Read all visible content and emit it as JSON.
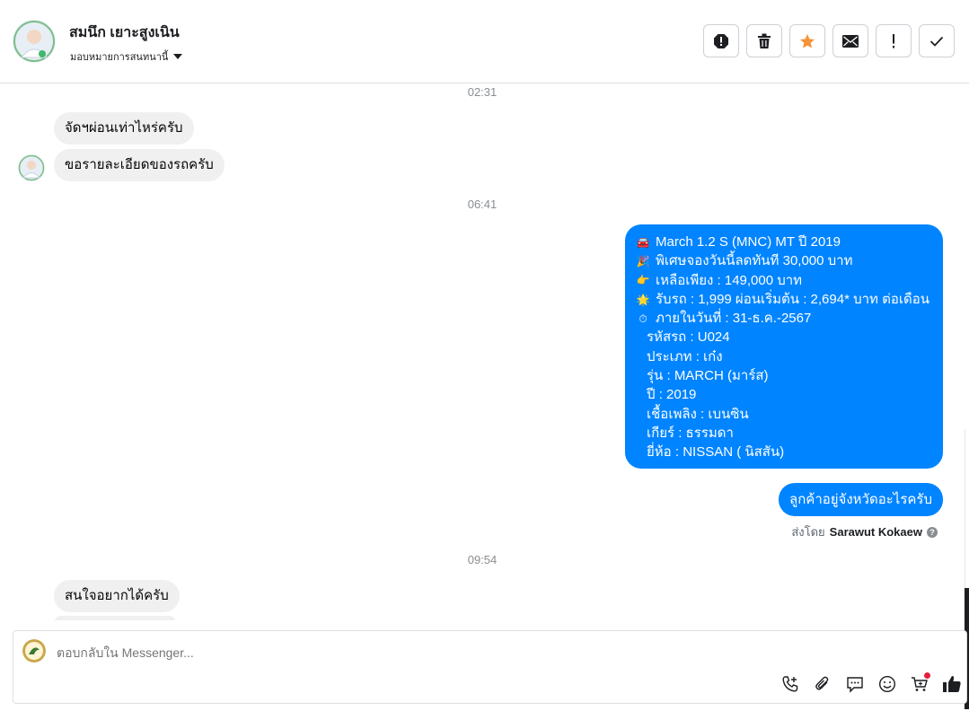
{
  "header": {
    "contact_name": "สมนึก เยาะสูงเนิน",
    "assign_label": "มอบหมายการสนทนานี้",
    "actions": [
      {
        "name": "spam-icon"
      },
      {
        "name": "trash-icon"
      },
      {
        "name": "star-icon"
      },
      {
        "name": "mail-icon"
      },
      {
        "name": "exclaim-icon"
      },
      {
        "name": "check-icon"
      }
    ]
  },
  "thread": {
    "timestamps": [
      "02:31",
      "06:41",
      "09:54"
    ],
    "incoming_1": "จัดฯผ่อนเท่าไหร่ครับ",
    "incoming_2": "ขอรายละเอียดของรถครับ",
    "outgoing_details": [
      {
        "icon": "🚘",
        "text": "March 1.2 S (MNC) MT ปี 2019"
      },
      {
        "icon": "🎉",
        "text": "พิเศษจองวันนี้ลดทันที 30,000 บาท"
      },
      {
        "icon": "👉",
        "text": "เหลือเพียง : 149,000 บาท"
      },
      {
        "icon": "🌟",
        "text": "รับรถ : 1,999 ผ่อนเริ่มต้น : 2,694* บาท ต่อเดือน"
      },
      {
        "icon": "⏱",
        "text": " ภายในวันที่ : 31-ธ.ค.-2567"
      },
      {
        "icon": "",
        "text": "รหัสรถ : U024"
      },
      {
        "icon": "",
        "text": "ประเภท : เก๋ง"
      },
      {
        "icon": "",
        "text": "รุ่น : MARCH (มาร์ส)"
      },
      {
        "icon": "",
        "text": "ปี : 2019"
      },
      {
        "icon": "",
        "text": "เชื้อเพลิง : เบนซิน"
      },
      {
        "icon": "",
        "text": "เกียร์ : ธรรมดา"
      },
      {
        "icon": "",
        "text": "ยี่ห้อ : NISSAN ( นิสสัน)"
      }
    ],
    "outgoing_question": "ลูกค้าอยู่จังหวัดอะไรครับ",
    "sent_by_prefix": "ส่งโดย",
    "sent_by_name": "Sarawut Kokaew",
    "incoming_3": "สนใจอยากได้ครับ"
  },
  "composer": {
    "placeholder": "ตอบกลับใน Messenger...",
    "icons": [
      "phone-add-icon",
      "paperclip-icon",
      "chat-icon",
      "emoji-icon",
      "cart-add-icon",
      "thumbs-up-icon"
    ]
  },
  "colors": {
    "outgoing_bubble": "#0084ff",
    "incoming_bubble": "#f0f0f0",
    "star": "#f7923b"
  }
}
